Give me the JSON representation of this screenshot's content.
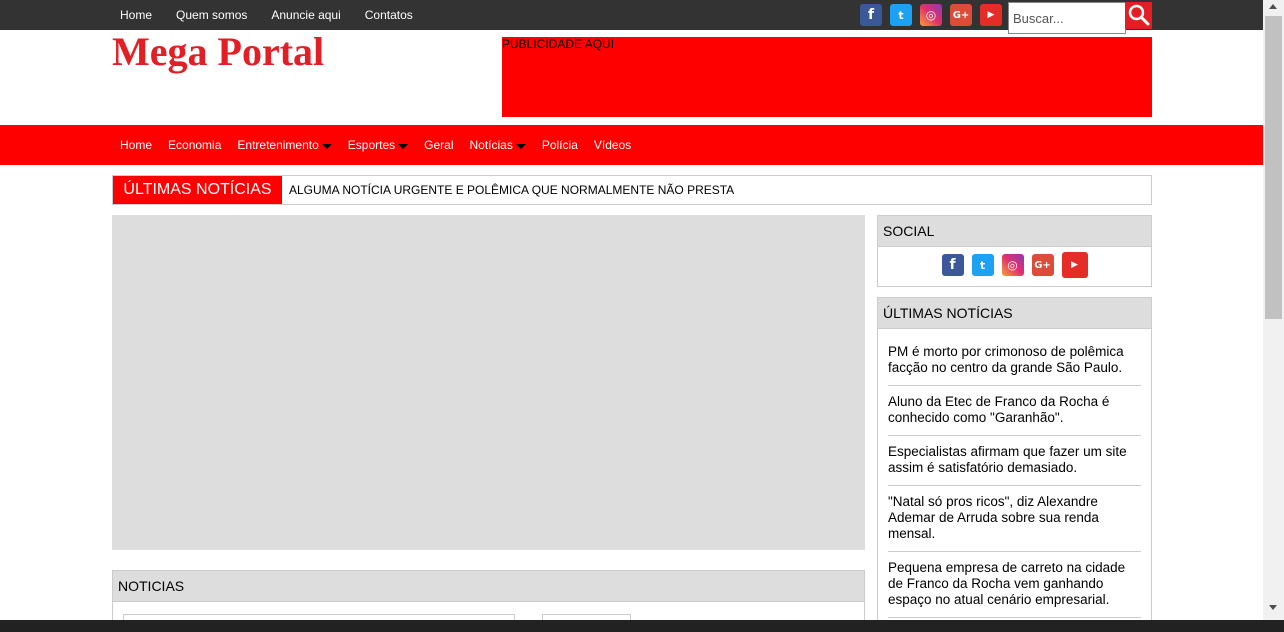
{
  "topbar": {
    "links": [
      "Home",
      "Quem somos",
      "Anuncie aqui",
      "Contatos"
    ],
    "social_icons": [
      "facebook-icon",
      "twitter-icon",
      "instagram-icon",
      "google-plus-icon",
      "youtube-icon"
    ],
    "search_placeholder": "Buscar..."
  },
  "header": {
    "logo": "Mega Portal",
    "ad_label": "PUBLICIDADE AQUI"
  },
  "nav": {
    "items": [
      {
        "label": "Home",
        "dropdown": false
      },
      {
        "label": "Economia",
        "dropdown": false
      },
      {
        "label": "Entretenimento",
        "dropdown": true
      },
      {
        "label": "Esportes",
        "dropdown": true
      },
      {
        "label": "Geral",
        "dropdown": false
      },
      {
        "label": "Notícias",
        "dropdown": true
      },
      {
        "label": "Polícia",
        "dropdown": false
      },
      {
        "label": "Vídeos",
        "dropdown": false
      }
    ]
  },
  "ticker": {
    "label": "ÚLTIMAS NOTÍCIAS",
    "text": "ALGUMA NOTÍCIA URGENTE E POLÊMICA QUE NORMALMENTE NÃO PRESTA"
  },
  "noticias": {
    "title": "NOTICIAS"
  },
  "sidebar": {
    "social_title": "SOCIAL",
    "latest_title": "ÚLTIMAS NOTÍCIAS",
    "latest_items": [
      "PM é morto por crimonoso de polêmica facção no centro da grande São Paulo.",
      "Aluno da Etec de Franco da Rocha é conhecido como \"Garanhão\".",
      "Especialistas afirmam que fazer um site assim é satisfatório demasiado.",
      "\"Natal só pros ricos\", diz Alexandre Ademar de Arruda sobre sua renda mensal.",
      "Pequena empresa de carreto na cidade de Franco da Rocha vem ganhando espaço no atual cenário empresarial."
    ]
  },
  "colors": {
    "topbar": "#333333",
    "accent_red": "#ff0000",
    "logo_red": "#e31e24",
    "panel_gray": "#dddddd"
  }
}
